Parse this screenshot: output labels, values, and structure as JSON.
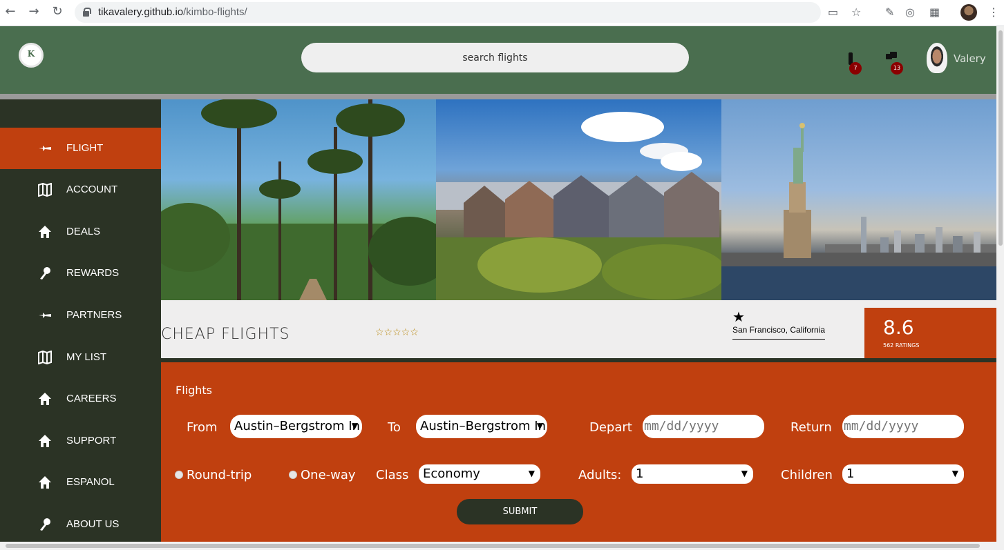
{
  "browser": {
    "url_host": "tikavalery.github.io",
    "url_path": "/kimbo-flights/",
    "icons": [
      "back-icon",
      "forward-icon",
      "reload-icon",
      "lock-icon",
      "cast-icon",
      "star-icon",
      "eyedropper-icon",
      "extension-icon",
      "puzzle-icon",
      "profile-avatar",
      "more-icon"
    ]
  },
  "header": {
    "search_placeholder": "search flights",
    "notifications": {
      "badge": "7",
      "icon": "bell-icon"
    },
    "messages": {
      "badge": "13",
      "icon": "chat-icon"
    },
    "username": "Valery",
    "colors": {
      "header_bg": "#4a6e4f",
      "accent": "#c0400f",
      "sidebar_bg": "#2b3325"
    }
  },
  "sidebar": {
    "items": [
      {
        "label": "FLIGHT",
        "icon": "plane-icon",
        "active": true
      },
      {
        "label": "ACCOUNT",
        "icon": "map-icon",
        "active": false
      },
      {
        "label": "DEALS",
        "icon": "home-icon",
        "active": false
      },
      {
        "label": "REWARDS",
        "icon": "key-icon",
        "active": false
      },
      {
        "label": "PARTNERS",
        "icon": "plane-icon",
        "active": false
      },
      {
        "label": "MY LIST",
        "icon": "map-icon",
        "active": false
      },
      {
        "label": "CAREERS",
        "icon": "home-icon",
        "active": false
      },
      {
        "label": "SUPPORT",
        "icon": "home-icon",
        "active": false
      },
      {
        "label": "ESPANOL",
        "icon": "home-icon",
        "active": false
      },
      {
        "label": "ABOUT US",
        "icon": "key-icon",
        "active": false
      }
    ]
  },
  "info": {
    "title": "CHEAP FLIGHTS",
    "stars": "☆☆☆☆☆",
    "location_star": "★",
    "location": "San Francisco, California",
    "rating": "8.6",
    "rating_count": "562 RATINGS"
  },
  "form": {
    "title": "Flights",
    "from_label": "From",
    "from_value": "Austin–Bergstrom In",
    "to_label": "To",
    "to_value": "Austin–Bergstrom In",
    "depart_label": "Depart",
    "depart_placeholder": "mm/dd/yyyy",
    "return_label": "Return",
    "return_placeholder": "mm/dd/yyyy",
    "roundtrip_label": "Round-trip",
    "oneway_label": "One-way",
    "class_label": "Class",
    "class_value": "Economy",
    "adults_label": "Adults:",
    "adults_value": "1",
    "children_label": "Children",
    "children_value": "1",
    "submit_label": "SUBMIT"
  }
}
